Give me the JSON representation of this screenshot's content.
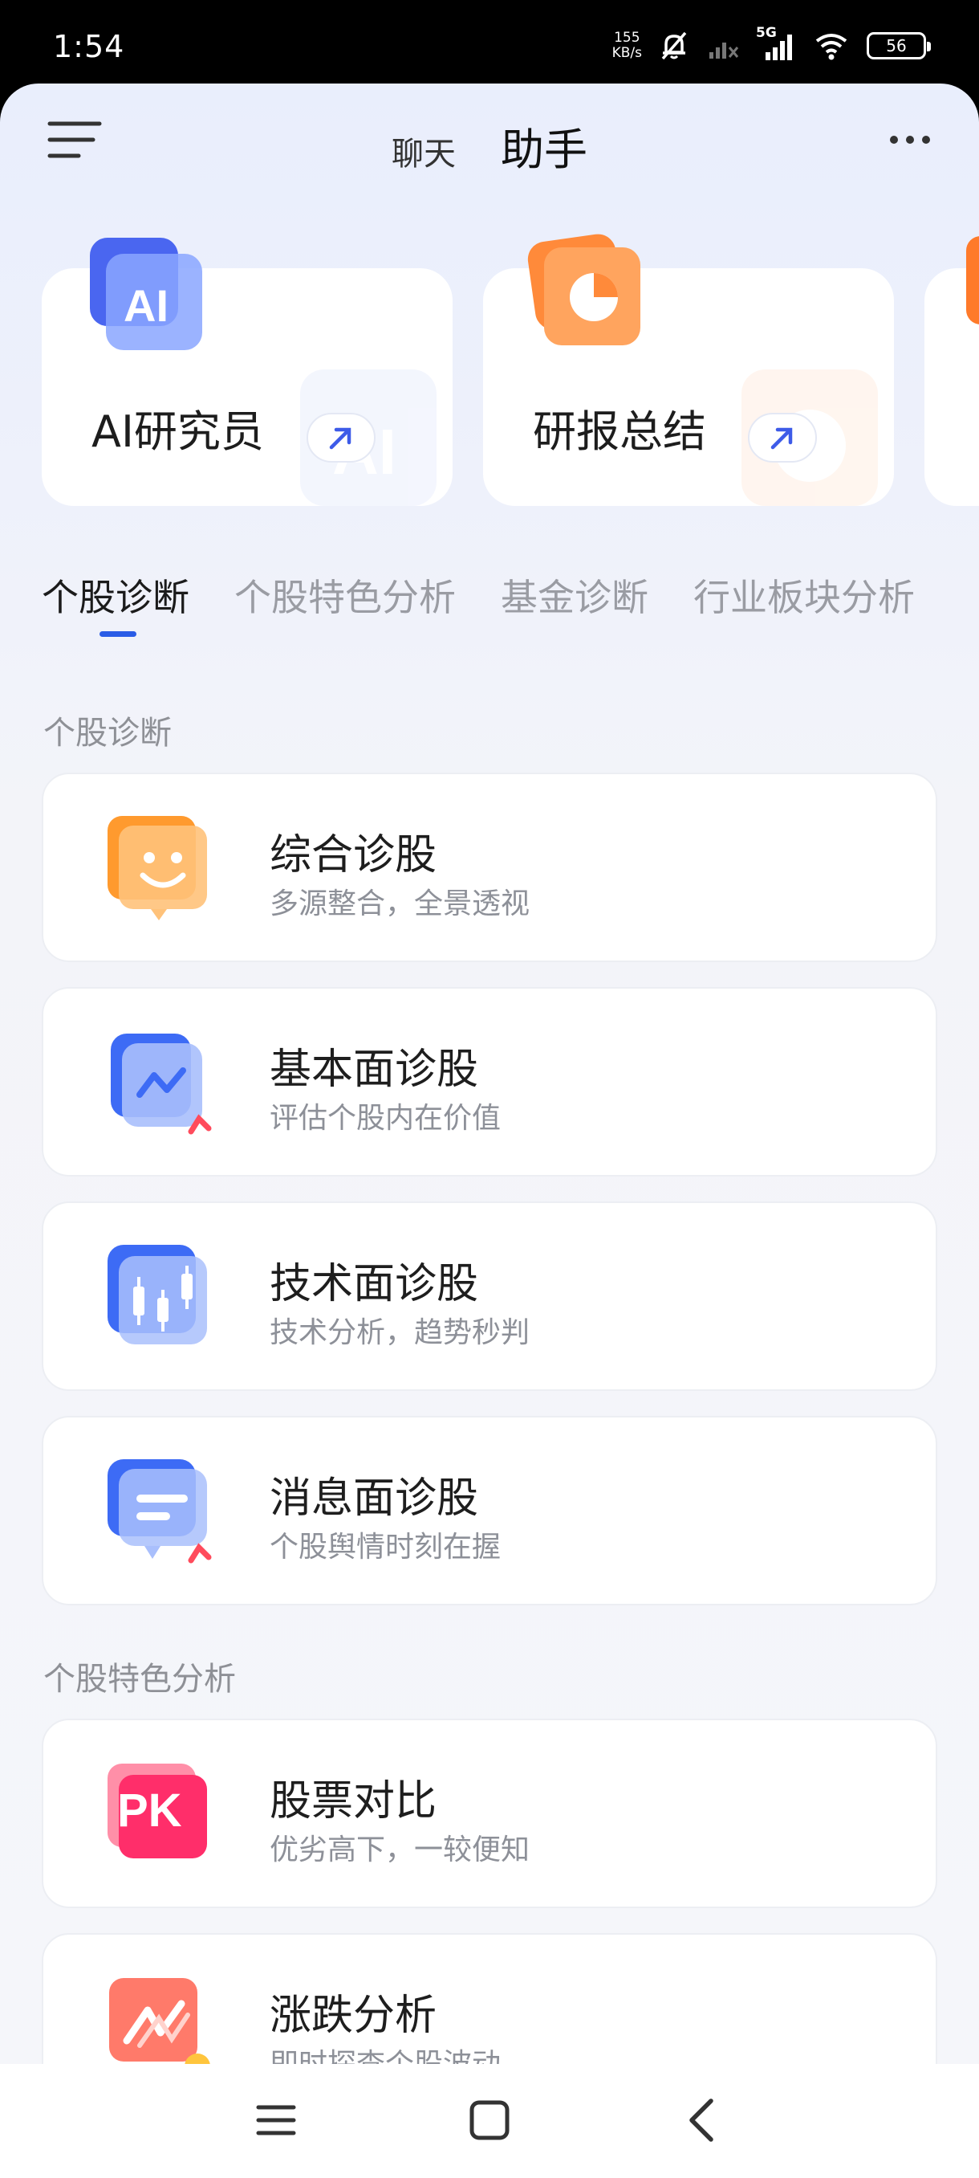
{
  "status_bar": {
    "time": "1:54",
    "net_speed_value": "155",
    "net_speed_unit": "KB/s",
    "network": "5G",
    "battery": "56"
  },
  "header": {
    "tab_chat": "聊天",
    "tab_assistant": "助手"
  },
  "features": [
    {
      "title": "AI研究员",
      "icon": "ai-icon",
      "icon_text": "AI"
    },
    {
      "title": "研报总结",
      "icon": "pie-chart-icon"
    }
  ],
  "category_tabs": [
    "个股诊断",
    "个股特色分析",
    "基金诊断",
    "行业板块分析"
  ],
  "sections": [
    {
      "title": "个股诊断",
      "items": [
        {
          "title": "综合诊股",
          "subtitle": "多源整合，全景透视",
          "icon": "smiley-chat-icon"
        },
        {
          "title": "基本面诊股",
          "subtitle": "评估个股内在价值",
          "icon": "trend-card-icon"
        },
        {
          "title": "技术面诊股",
          "subtitle": "技术分析，趋势秒判",
          "icon": "candlestick-icon"
        },
        {
          "title": "消息面诊股",
          "subtitle": "个股舆情时刻在握",
          "icon": "message-icon"
        }
      ]
    },
    {
      "title": "个股特色分析",
      "items": [
        {
          "title": "股票对比",
          "subtitle": "优劣高下，一较便知",
          "icon": "pk-icon",
          "icon_text": "PK"
        },
        {
          "title": "涨跌分析",
          "subtitle": "即时探查个股波动",
          "icon": "rise-fall-icon"
        }
      ]
    }
  ],
  "colors": {
    "accent": "#2a5ce6",
    "orange": "#ff7a2a",
    "blue_icon": "#3d6bf5",
    "pink": "#ff3d6b"
  }
}
